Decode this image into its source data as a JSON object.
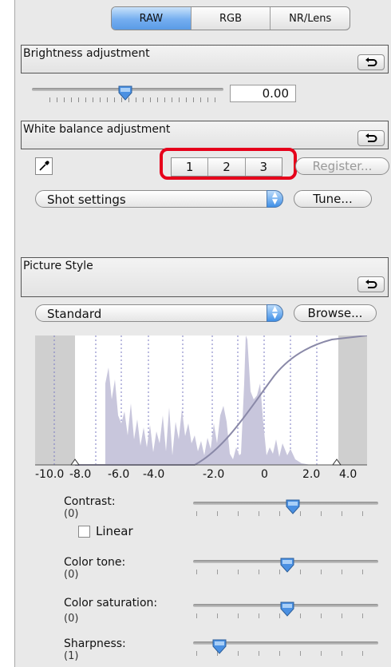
{
  "tabs": [
    "RAW",
    "RGB",
    "NR/Lens"
  ],
  "brightness": {
    "title": "Brightness adjustment",
    "value": "0.00"
  },
  "white_balance": {
    "title": "White balance adjustment",
    "buttons": [
      "1",
      "2",
      "3"
    ],
    "register_label": "Register...",
    "select_value": "Shot settings",
    "tune_label": "Tune..."
  },
  "picture_style": {
    "title": "Picture Style",
    "select_value": "Standard",
    "browse_label": "Browse...",
    "histogram_axis": [
      "-10.0",
      "-8.0",
      "-6.0",
      "-4.0",
      "-2.0",
      "0",
      "2.0",
      "4.0"
    ],
    "contrast": {
      "label": "Contrast:",
      "value": "(0)",
      "level": 0
    },
    "linear": {
      "label": "Linear",
      "checked": false
    },
    "color_tone": {
      "label": "Color tone:",
      "value": "(0)",
      "level": 0
    },
    "color_saturation": {
      "label": "Color saturation:",
      "value": "(0)",
      "level": 0
    },
    "sharpness": {
      "label": "Sharpness:",
      "value": "(1)",
      "level": 1
    }
  },
  "colors": {
    "active_tab": "#74aef0",
    "highlight_box": "#e6001b",
    "histogram_fill": "#c8c6dc",
    "curve": "#8a89a8"
  },
  "icons": {
    "reset": "reset-arrow-icon",
    "eyedropper": "eyedropper-icon",
    "slider_thumb": "slider-thumb-icon"
  }
}
